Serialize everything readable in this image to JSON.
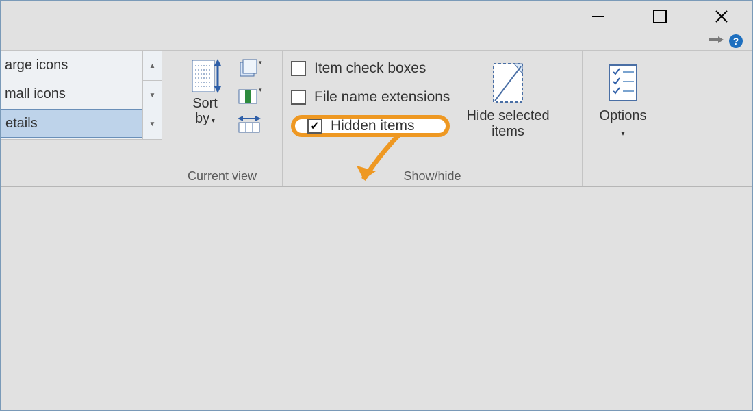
{
  "window_controls": {
    "minimize": "minimize",
    "maximize": "maximize",
    "close": "close"
  },
  "subbar": {
    "pin": "pin",
    "help": "?"
  },
  "layout_list": {
    "items": [
      "arge icons",
      "mall icons",
      "etails"
    ],
    "selected_index": 2
  },
  "current_view": {
    "sort_by_line1": "Sort",
    "sort_by_line2": "by",
    "group_label": "Current view"
  },
  "show_hide": {
    "item_check_boxes": "Item check boxes",
    "file_name_extensions": "File name extensions",
    "hidden_items": "Hidden items",
    "hide_selected_line1": "Hide selected",
    "hide_selected_line2": "items",
    "group_label": "Show/hide"
  },
  "options": {
    "label": "Options"
  },
  "checkbox_states": {
    "item_check_boxes": false,
    "file_name_extensions": false,
    "hidden_items": true
  }
}
